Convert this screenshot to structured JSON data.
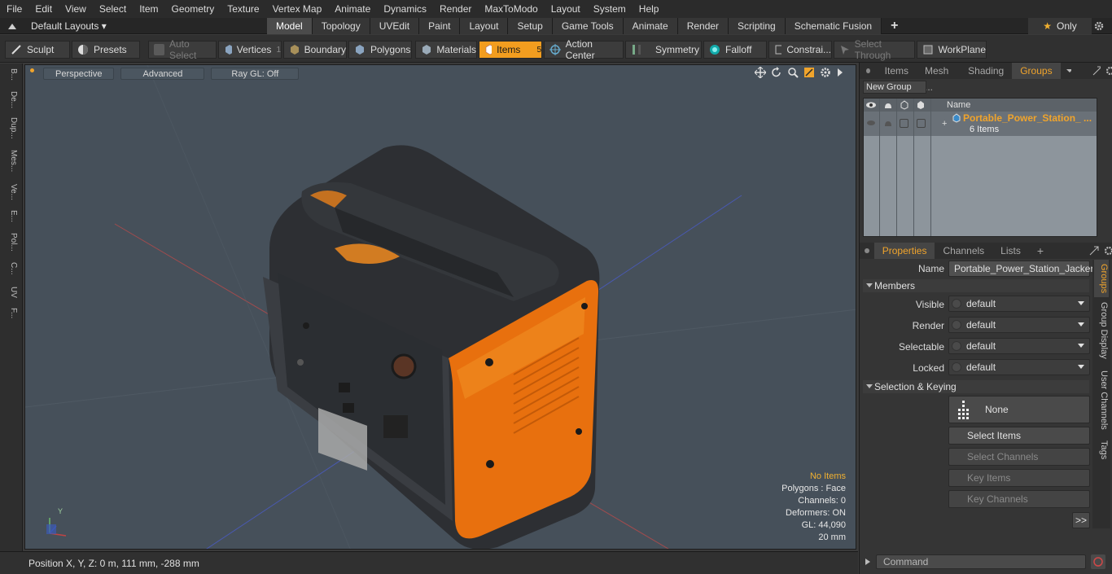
{
  "menu": [
    "File",
    "Edit",
    "View",
    "Select",
    "Item",
    "Geometry",
    "Texture",
    "Vertex Map",
    "Animate",
    "Dynamics",
    "Render",
    "MaxToModo",
    "Layout",
    "System",
    "Help"
  ],
  "layouts": {
    "label": "Default Layouts ▾"
  },
  "tabs": [
    "Model",
    "Topology",
    "UVEdit",
    "Paint",
    "Layout",
    "Setup",
    "Game Tools",
    "Animate",
    "Render",
    "Scripting",
    "Schematic Fusion"
  ],
  "only": {
    "star": "★",
    "label": "Only"
  },
  "toolbar": {
    "sculpt": "Sculpt",
    "presets": "Presets",
    "auto_select": "Auto Select",
    "vertices": "Vertices",
    "vertices_count": "1",
    "boundary": "Boundary",
    "polygons": "Polygons",
    "materials": "Materials",
    "items": "Items",
    "items_count": "5",
    "action_center": "Action Center",
    "symmetry": "Symmetry",
    "falloff": "Falloff",
    "constraints": "Constrai...",
    "select_through": "Select Through",
    "workplane": "WorkPlane"
  },
  "left_tabs": [
    "B...",
    "De...",
    "Dup...",
    "Mes...",
    "Ve...",
    "E...",
    "Pol...",
    "C...",
    "UV",
    "F..."
  ],
  "viewport": {
    "perspective": "Perspective",
    "advanced": "Advanced",
    "raygl": "Ray GL: Off",
    "stats": {
      "no_items": "No Items",
      "polygons": "Polygons : Face",
      "channels": "Channels: 0",
      "deformers": "Deformers: ON",
      "gl": "GL: 44,090",
      "unit": "20 mm"
    },
    "axis_y": "Y"
  },
  "status": {
    "position": "Position X, Y, Z:   0 m, 111 mm, -288 mm"
  },
  "groups_panel": {
    "tabs": [
      "Items",
      "Mesh ...",
      "Shading",
      "Groups"
    ],
    "new_group": "New Group",
    "col_name": "Name",
    "group_name": "Portable_Power_Station_ ...",
    "group_count": "6 Items"
  },
  "properties": {
    "tabs": [
      "Properties",
      "Channels",
      "Lists"
    ],
    "name_label": "Name",
    "name_value": "Portable_Power_Station_Jackery",
    "members": "Members",
    "visible_label": "Visible",
    "render_label": "Render",
    "selectable_label": "Selectable",
    "locked_label": "Locked",
    "default_value": "default",
    "selection_keying": "Selection & Keying",
    "none": "None",
    "select_items": "Select Items",
    "select_channels": "Select Channels",
    "key_items": "Key Items",
    "key_channels": "Key Channels",
    "more": ">>",
    "vtabs": [
      "Groups",
      "Group Display",
      "User Channels",
      "Tags"
    ]
  },
  "command": {
    "placeholder": "Command"
  },
  "colors": {
    "accent": "#f29d1f",
    "viewport": "#46505a"
  }
}
